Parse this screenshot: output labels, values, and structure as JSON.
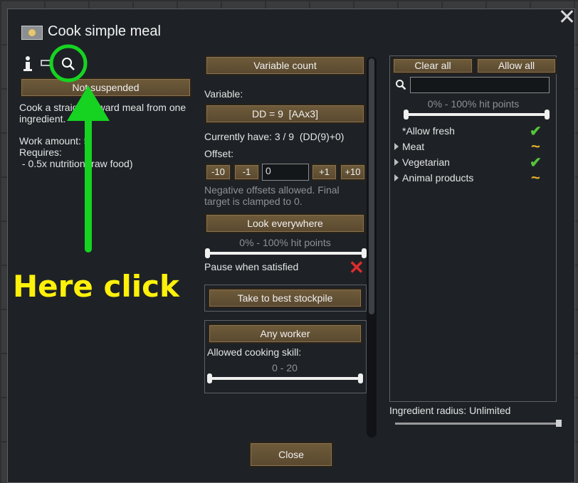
{
  "window": {
    "title": "Cook simple meal"
  },
  "left": {
    "suspend_button": "Not suspended",
    "description": "Cook a straightforward meal from one ingredient.",
    "work_amount": "Work amount: 5",
    "requires_label": "Requires:",
    "requirement": " - 0.5x nutrition (raw food)"
  },
  "middle": {
    "variable_count_button": "Variable count",
    "variable_label": "Variable:",
    "variable_button": "DD = 9  [AAx3]",
    "currently_have": "Currently have: 3 / 9  (DD(9)+0)",
    "offset_label": "Offset:",
    "offset_buttons": {
      "minus10": "-10",
      "minus1": "-1",
      "plus1": "+1",
      "plus10": "+10"
    },
    "offset_value": "0",
    "offset_note": "Negative offsets allowed. Final target is clamped to 0.",
    "look_button": "Look everywhere",
    "hit_points_range": "0% - 100% hit points",
    "pause_label": "Pause when satisfied",
    "stockpile_button": "Take to best stockpile",
    "worker_button": "Any worker",
    "skill_label": "Allowed cooking skill:",
    "skill_range": "0 - 20",
    "close_button": "Close"
  },
  "right": {
    "clear_all": "Clear all",
    "allow_all": "Allow all",
    "search_placeholder": "",
    "hit_points_range": "0% - 100% hit points",
    "items": [
      {
        "label": "*Allow fresh",
        "state": "allowed"
      },
      {
        "label": "Meat",
        "state": "partial"
      },
      {
        "label": "Vegetarian",
        "state": "allowed"
      },
      {
        "label": "Animal products",
        "state": "partial"
      }
    ],
    "radius_label": "Ingredient radius: Unlimited"
  },
  "annotation": {
    "text": "Here click"
  },
  "colors": {
    "button": "#6e5b3a",
    "allowed": "#55c43a",
    "partial": "#e4ad2a",
    "annotation": "#16d321",
    "annotation_text": "#fff10a"
  }
}
